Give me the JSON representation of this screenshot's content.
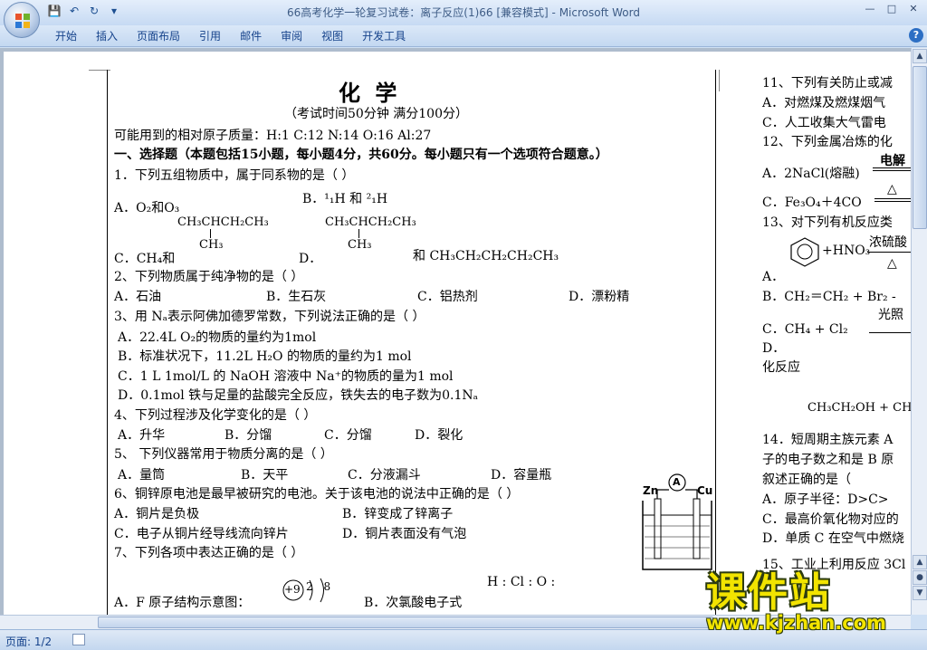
{
  "window": {
    "title": "66高考化学一轮复习试卷：离子反应(1)66 [兼容模式]",
    "app_name": "Microsoft Word",
    "separator": " - "
  },
  "ribbon": {
    "tabs": [
      "开始",
      "插入",
      "页面布局",
      "引用",
      "邮件",
      "审阅",
      "视图",
      "开发工具"
    ]
  },
  "status": {
    "page": "页面: 1/2"
  },
  "doc": {
    "title": "化    学",
    "subtitle": "（考试时间50分钟   满分100分）",
    "atomic": "可能用到的相对原子质量：H:1  C:12  N:14  O:16  Al:27",
    "section1": "一、选择题（本题包括15小题，每小题4分，共60分。每小题只有一个选项符合题意。）",
    "q1": "1．下列五组物质中，属于同系物的是（    ）",
    "q1a": "A．O₂和O₃",
    "q1b": "B．¹₁H 和 ²₁H",
    "q1c_struct": "CH₃CHCH₂CH₃",
    "q1c_sub": "CH₃",
    "q1c_label": "C．CH₄和",
    "q1d_label": "D．",
    "q1d_struct": "CH₃CHCH₂CH₃",
    "q1d_sub": "CH₃",
    "q1d_and": "和 CH₃CH₂CH₂CH₂CH₃",
    "q2": "2、下列物质属于纯净物的是（      ）",
    "q2opts": [
      "A．石油",
      "B．生石灰",
      "C．铝热剂",
      "D．漂粉精"
    ],
    "q3": "3、用 Nₐ表示阿佛加德罗常数，下列说法正确的是（       ）",
    "q3a": "A．22.4L O₂的物质的量约为1mol",
    "q3b": "B．标准状况下，11.2L H₂O 的物质的量约为1 mol",
    "q3c": "C．1 L  1mol/L 的 NaOH 溶液中 Na⁺的物质的量为1 mol",
    "q3d": "D．0.1mol 铁与足量的盐酸完全反应，铁失去的电子数为0.1Nₐ",
    "q4": "4、下列过程涉及化学变化的是（      ）",
    "q4opts": [
      "A．升华",
      "B．分馏",
      "C．分馏",
      "D．裂化"
    ],
    "q5": "5、  下列仪器常用于物质分离的是（       ）",
    "q5opts": [
      "A．量筒",
      "B．天平",
      "C．分液漏斗",
      "D．容量瓶"
    ],
    "q6": "6、铜锌原电池是最早被研究的电池。关于该电池的说法中正确的是（      ）",
    "q6a": "A．铜片是负极",
    "q6b": "B．锌变成了锌离子",
    "q6c": "C．电子从铜片经导线流向锌片",
    "q6d": "D．铜片表面没有气泡",
    "cell_zn": "Zn",
    "cell_cu": "Cu",
    "cell_a": "A",
    "q7": "7、下列各项中表达正确的是（      ）",
    "q7a": "A．F 原子结构示意图：",
    "q7a_nucleus": "+9",
    "q7a_shells": "2 8",
    "q7b": "B．次氯酸电子式",
    "q7b_formula": "H : Cl : O :"
  },
  "right": {
    "q11": "11、下列有关防止或减",
    "q11a": "A．对燃煤及燃煤烟气",
    "q11c": "C．人工收集大气雷电",
    "q12": "12、下列金属冶炼的化",
    "q12a": "A．2NaCl(熔融)",
    "q12a_cond": "电解",
    "q12c": "C．Fe₃O₄＋4CO",
    "q12c_cond": "△",
    "q13": "13、对下列有机反应类",
    "q13_eq": "+HNO₃",
    "q13_cond1": "浓硫酸",
    "q13_cond2": "△",
    "q13a": "A．",
    "q13b": "B．CH₂＝CH₂  +  Br₂ -",
    "q13b_cond": "光照",
    "q13c": "C．CH₄  +  Cl₂",
    "q13d": "D．",
    "q13d2": "化反应",
    "q13e": "CH₃CH₂OH + CH",
    "q14": "14．短周期主族元素 A",
    "q14b": "子的电子数之和是 B 原",
    "q14c": "叙述正确的是（",
    "q14oa": "A．原子半径：D>C>",
    "q14ob": "C．最高价氧化物对应的",
    "q14oc": "D．单质 C 在空气中燃烧",
    "q15": "15、工业上利用反应 3Cl"
  },
  "watermark": {
    "title": "课件站",
    "url": "www.kjzhan.com"
  }
}
